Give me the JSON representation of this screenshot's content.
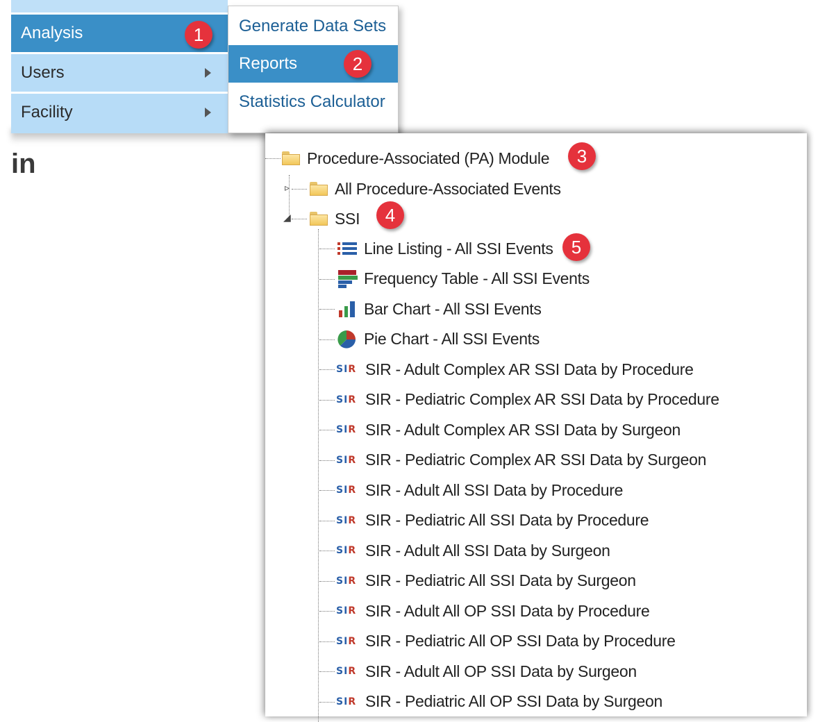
{
  "nav_menu": {
    "items": [
      {
        "label": "Analysis",
        "active": true
      },
      {
        "label": "Users",
        "has_submenu": true
      },
      {
        "label": "Facility",
        "has_submenu": true
      }
    ]
  },
  "submenu": {
    "items": [
      {
        "label": "Generate Data Sets"
      },
      {
        "label": "Reports",
        "active": true
      },
      {
        "label": "Statistics Calculator"
      }
    ]
  },
  "background_text": "in",
  "badges": [
    "1",
    "2",
    "3",
    "4",
    "5"
  ],
  "tree": {
    "root": {
      "label": "Procedure-Associated (PA) Module",
      "icon": "folder-icon"
    },
    "folders": [
      {
        "label": "All Procedure-Associated Events",
        "icon": "folder-icon"
      },
      {
        "label": "SSI",
        "icon": "folder-icon",
        "expanded": true
      }
    ],
    "reports": [
      {
        "label": "Line Listing - All SSI Events",
        "icon": "line-listing-icon"
      },
      {
        "label": "Frequency Table - All SSI Events",
        "icon": "frequency-table-icon"
      },
      {
        "label": "Bar Chart - All SSI Events",
        "icon": "bar-chart-icon"
      },
      {
        "label": "Pie Chart - All SSI Events",
        "icon": "pie-chart-icon"
      },
      {
        "label": "SIR - Adult Complex AR SSI Data by Procedure",
        "icon": "sir-icon"
      },
      {
        "label": "SIR - Pediatric Complex AR SSI Data by Procedure",
        "icon": "sir-icon"
      },
      {
        "label": "SIR - Adult Complex AR SSI Data by Surgeon",
        "icon": "sir-icon"
      },
      {
        "label": "SIR - Pediatric Complex AR SSI Data by Surgeon",
        "icon": "sir-icon"
      },
      {
        "label": "SIR - Adult All SSI Data by Procedure",
        "icon": "sir-icon"
      },
      {
        "label": "SIR - Pediatric All SSI Data by Procedure",
        "icon": "sir-icon"
      },
      {
        "label": "SIR - Adult All SSI Data by Surgeon",
        "icon": "sir-icon"
      },
      {
        "label": "SIR - Pediatric All SSI Data by Surgeon",
        "icon": "sir-icon"
      },
      {
        "label": "SIR - Adult All OP SSI Data by Procedure",
        "icon": "sir-icon"
      },
      {
        "label": "SIR - Pediatric All OP SSI Data by Procedure",
        "icon": "sir-icon"
      },
      {
        "label": "SIR - Adult All OP SSI Data by Surgeon",
        "icon": "sir-icon"
      },
      {
        "label": "SIR - Pediatric All OP SSI Data by Surgeon",
        "icon": "sir-icon"
      }
    ],
    "sir_icon_text": {
      "s": "S",
      "i": "I",
      "r": "R"
    }
  },
  "colors": {
    "menu_bg": "#b7dcf7",
    "menu_active": "#3a8fc7",
    "submenu_text": "#1c5f95",
    "badge": "#e5323c"
  }
}
